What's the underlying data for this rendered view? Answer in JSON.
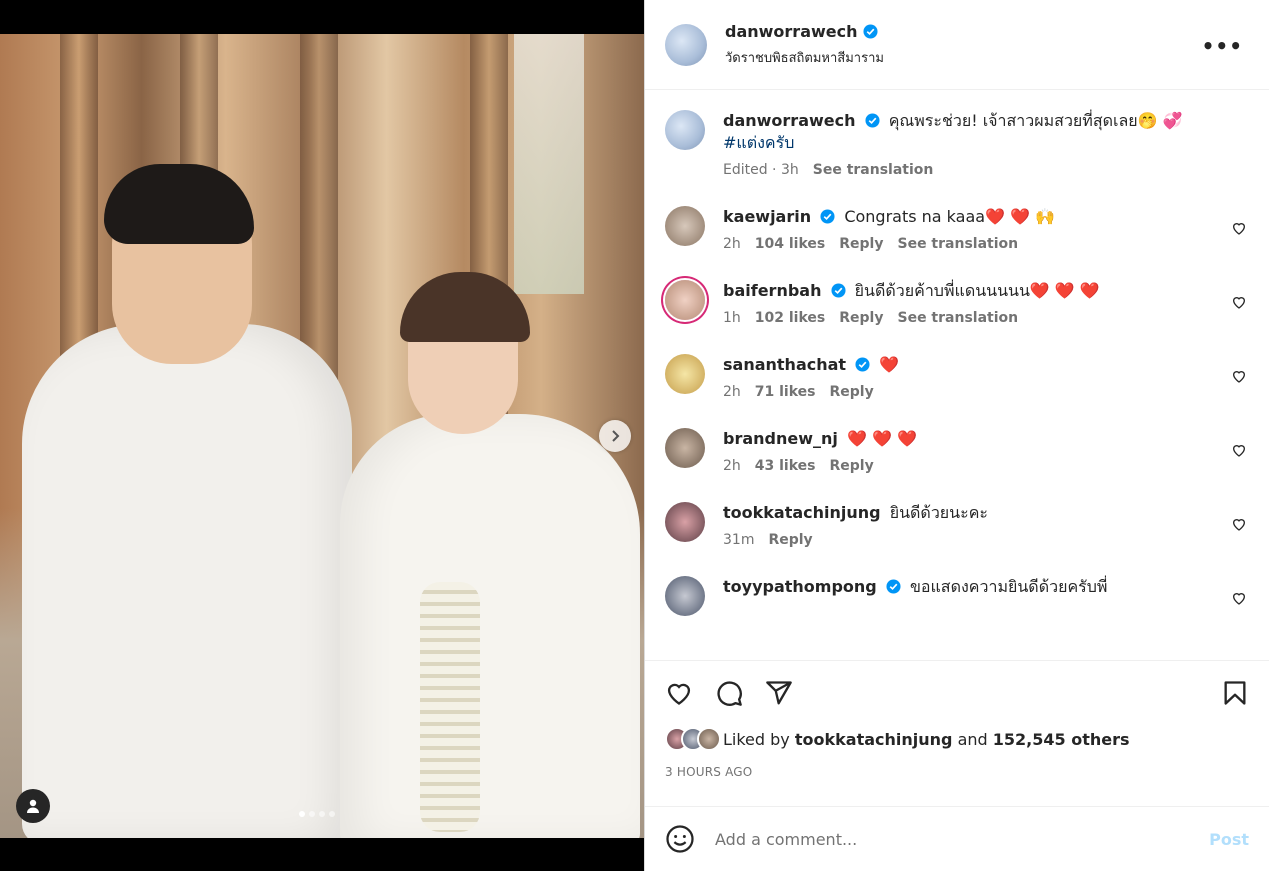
{
  "post": {
    "username": "danworrawech",
    "location": "วัดราชบพิธสถิตมหาสีมาราม",
    "caption_text": "คุณพระช่วย! เจ้าสาวผมสวยที่สุดเลย🤭 💞 ",
    "caption_hashtag": "#แต่งครับ",
    "caption_meta_time": "Edited · 3h",
    "see_translation": "See translation"
  },
  "comments": [
    {
      "user": "kaewjarin",
      "verified": true,
      "text": "Congrats na kaaa❤️ ❤️ 🙌",
      "time": "2h",
      "likes": "104 likes",
      "reply": "Reply",
      "translate": "See translation"
    },
    {
      "user": "baifernbah",
      "verified": true,
      "text": "ยินดีด้วยค้าบพี่แดนนนนน❤️ ❤️ ❤️",
      "time": "1h",
      "likes": "102 likes",
      "reply": "Reply",
      "translate": "See translation"
    },
    {
      "user": "sananthachat",
      "verified": true,
      "text": "❤️",
      "time": "2h",
      "likes": "71 likes",
      "reply": "Reply",
      "translate": ""
    },
    {
      "user": "brandnew_nj",
      "verified": false,
      "text": "❤️ ❤️ ❤️",
      "time": "2h",
      "likes": "43 likes",
      "reply": "Reply",
      "translate": ""
    },
    {
      "user": "tookkatachinjung",
      "verified": false,
      "text": "ยินดีด้วยนะคะ",
      "time": "31m",
      "likes": "",
      "reply": "Reply",
      "translate": ""
    },
    {
      "user": "toyypathompong",
      "verified": true,
      "text": "ขอแสดงความยินดีด้วยครับพี่",
      "time": "",
      "likes": "",
      "reply": "",
      "translate": ""
    }
  ],
  "engagement": {
    "liked_by_prefix": "Liked by",
    "liked_by_user": "tookkatachinjung",
    "and_text": "and",
    "others_count": "152,545 others",
    "timestamp": "3 HOURS AGO"
  },
  "composer": {
    "placeholder": "Add a comment...",
    "post_label": "Post"
  },
  "icons": {
    "more": "more-options-icon",
    "like": "heart-icon",
    "comment": "comment-icon",
    "share": "share-icon",
    "save": "bookmark-icon",
    "emoji": "emoji-icon",
    "next": "chevron-right-icon",
    "tags": "user-tag-icon"
  },
  "colors": {
    "verified": "#0095f6",
    "link": "#00376b",
    "muted": "#737373",
    "post_disabled": "#b2dffc"
  },
  "carousel": {
    "slides": 4,
    "active": 1
  }
}
